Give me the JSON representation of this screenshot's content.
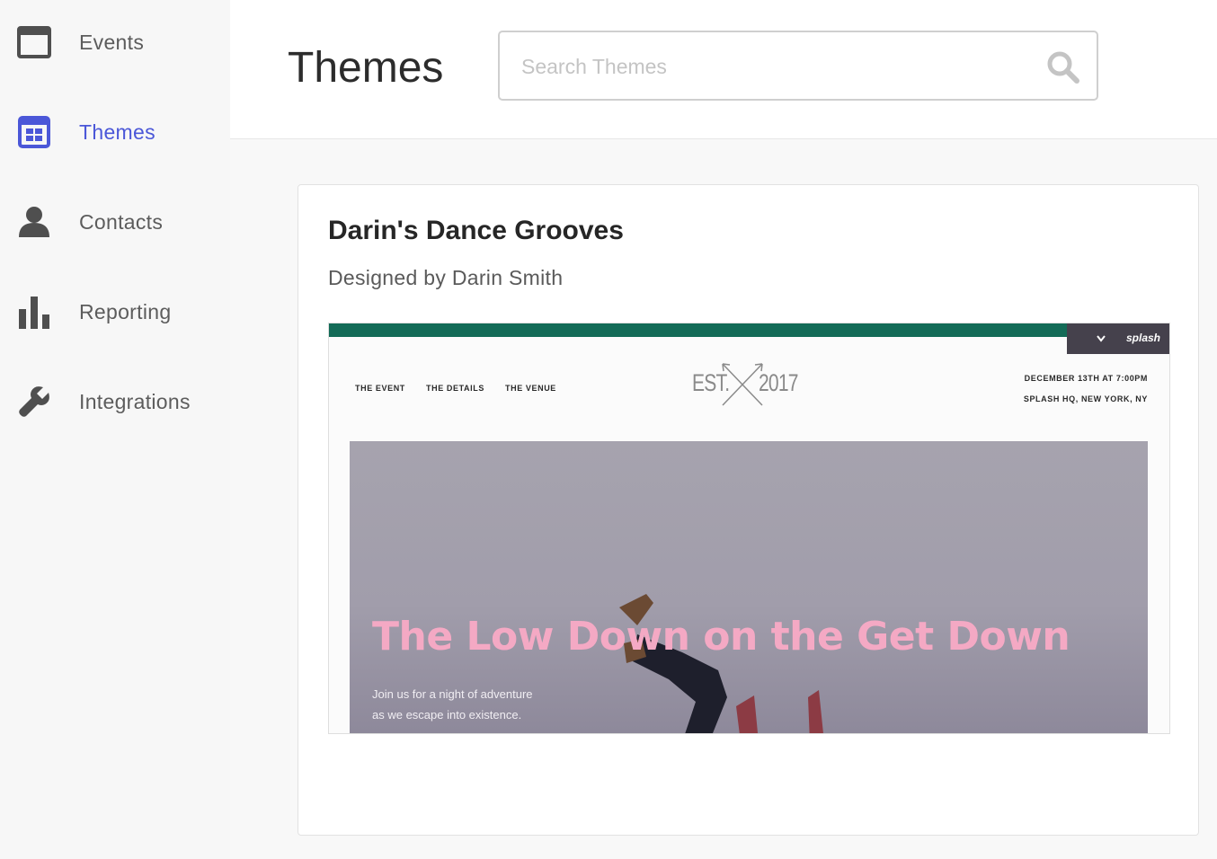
{
  "sidebar": {
    "items": [
      {
        "label": "Events",
        "icon": "calendar-window-icon",
        "active": false
      },
      {
        "label": "Themes",
        "icon": "layout-grid-icon",
        "active": true
      },
      {
        "label": "Contacts",
        "icon": "person-icon",
        "active": false
      },
      {
        "label": "Reporting",
        "icon": "bar-chart-icon",
        "active": false
      },
      {
        "label": "Integrations",
        "icon": "wrench-icon",
        "active": false
      }
    ]
  },
  "header": {
    "title": "Themes",
    "search_placeholder": "Search Themes"
  },
  "theme_card": {
    "title": "Darin's Dance Grooves",
    "designer": "Designed by Darin Smith",
    "preview": {
      "brand": "splash",
      "nav": [
        "THE EVENT",
        "THE DETAILS",
        "THE VENUE"
      ],
      "logo_left": "EST.",
      "logo_right": "2017",
      "date": "DECEMBER 13TH AT 7:00PM",
      "location": "SPLASH HQ, NEW YORK, NY",
      "hero_title": "The Low Down on the Get Down",
      "hero_line1": "Join us for a night of adventure",
      "hero_line2": "as we escape into existence."
    }
  },
  "colors": {
    "accent": "#4b57d8",
    "preview_bar": "#136b57",
    "hero_title": "#f4a9c4",
    "icon_gray": "#4f4f4f"
  }
}
